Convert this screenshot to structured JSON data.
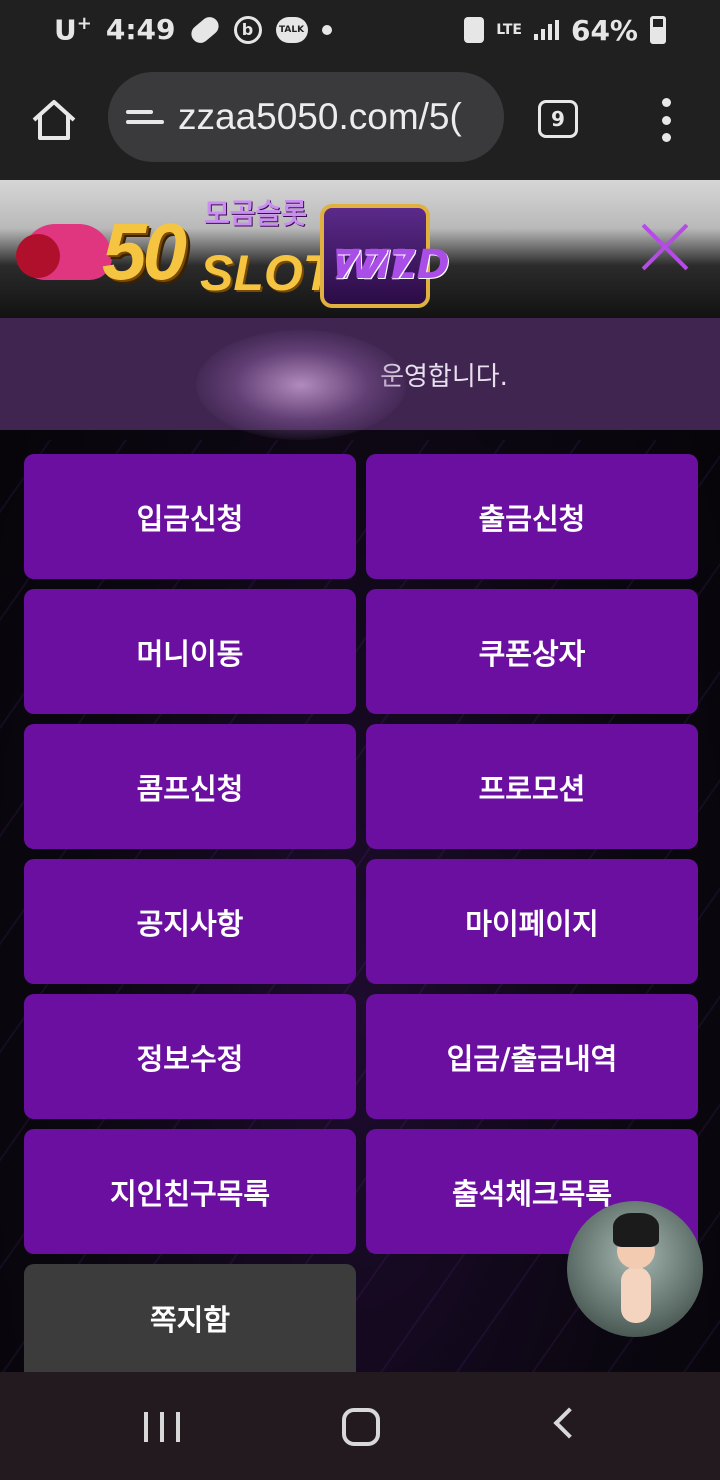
{
  "status_bar": {
    "carrier": "U",
    "carrier_sup": "+",
    "time": "4:49",
    "icons": [
      "pill-icon",
      "b-app-icon",
      "kakaotalk-icon"
    ],
    "talk_label": "TALK",
    "network": "LTE",
    "battery": "64%",
    "battery_level": 0.64
  },
  "browser": {
    "url": "zzaa5050.com/5(",
    "tab_count": "9"
  },
  "site": {
    "logo_number": "50",
    "logo_word": "SLOT",
    "logo_korean": "모곰슬롯",
    "logo_reel": "777",
    "logo_wild": "WILD",
    "notice": "운영합니다."
  },
  "menu": {
    "deposit_request": "입금신청",
    "withdraw_request": "출금신청",
    "money_transfer": "머니이동",
    "coupon_box": "쿠폰상자",
    "comp_request": "콤프신청",
    "promotion": "프로모션",
    "notice": "공지사항",
    "my_page": "마이페이지",
    "edit_info": "정보수정",
    "deposit_withdraw_history": "입금/출금내역",
    "referral_list": "지인친구목록",
    "attendance_list": "출석체크목록",
    "inbox": "쪽지함"
  }
}
